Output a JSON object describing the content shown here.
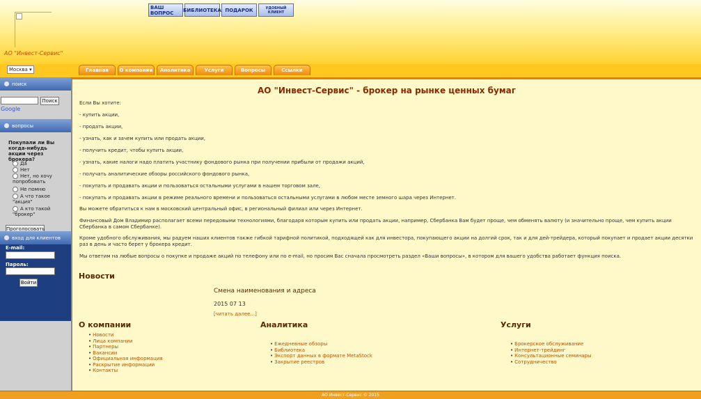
{
  "header": {
    "company": "АО \"Инвест-Сервис\"",
    "icons": [
      "ВАШ ВОПРОС",
      "БИБЛИОТЕКА",
      "ПОДАРОК",
      "УДОБНЫЙ КЛИЕНТ"
    ]
  },
  "nav": {
    "city": "Москва",
    "tabs": [
      "Главная",
      "О компании",
      "Аналитика",
      "Услуги",
      "Вопросы",
      "Ссылки"
    ]
  },
  "sidebar": {
    "search": {
      "title": "поиск",
      "button": "Поиск",
      "google": "Google"
    },
    "poll": {
      "title": "вопросы",
      "question": "Покупали ли Вы когда-нибудь акции через брокера?",
      "options": [
        "Да",
        "Нет",
        "Нет, но хочу попробовать",
        "Не помню",
        "А что такое \"акция\"",
        "А кто такой \"брокер\""
      ],
      "button": "Проголосовать"
    },
    "login": {
      "title": "вход для клиентов",
      "email_label": "E-mail:",
      "password_label": "Пароль:",
      "button": "Войти"
    }
  },
  "main": {
    "title": "АО \"Инвест-Сервис\" - брокер на рынке ценных бумаг",
    "intro": "Если Вы хотите:",
    "items": [
      "- купить акции,",
      "- продать акции,",
      "- узнать, как и зачем купить или продать акции,",
      "- получить кредит, чтобы купить акции,",
      "- узнать, какие налоги надо платить участнику фондового рынка при получении прибыли от продажи акций,",
      "- получать аналитические обзоры российского фондового рынка,",
      "- покупать и продавать акции и пользоваться остальными услугами в нашем торговом зале,",
      "- покупать и продавать акции в режиме реального времени и пользоваться остальными услугами в любом месте земного шара через Интернет."
    ],
    "contact": "Вы можете обратиться к нам в московский центральный офис, в региональный филиал или через Интернет.",
    "para1": "Финансовый Дом Владимир располагает всеми передовыми технологиями, благодаря которым купить или продать акции, например, Сбербанка Вам будет проще, чем обменять валюту (и значительно проще, чем купить акции Сбербанка в самом Сбербанке).",
    "para2": "Кроме удобного обслуживания, мы радуем наших клиентов также гибкой тарифной политикой, подходящей как для инвестора, покупающего акции на долгий срок, так и для дей-трейдера, который покупает и продает акции десятки раз в день и часто берет у брокера кредит.",
    "para3": "Мы ответим на любые вопросы о покупке и продаже акций по телефону или по e-mail, но просим Вас сначала просмотреть раздел «Ваши вопросы», в котором для вашего удобства работает функция поиска."
  },
  "news": {
    "heading": "Новости",
    "title": "Смена наименования и адреса",
    "date": "2015 07 13",
    "more": "[читать далее...]"
  },
  "columns": [
    {
      "heading": "О компании",
      "items": [
        "Новости",
        "Лица компании",
        "Партнеры",
        "Вакансии",
        "Официальная информация",
        "Раскрытие информации",
        "Контакты"
      ]
    },
    {
      "heading": "Аналитика",
      "items": [
        "Ежедневные обзоры",
        "Библиотека",
        "Экспорт данных в формате MetaStock",
        "Закрытие реестров"
      ]
    },
    {
      "heading": "Услуги",
      "items": [
        "Брокерское обслуживание",
        "Интернет-трейдинг",
        "Консультационные семинары",
        "Сотрудничество"
      ]
    }
  ],
  "footer": "АО Инвест-Сервис © 2015"
}
